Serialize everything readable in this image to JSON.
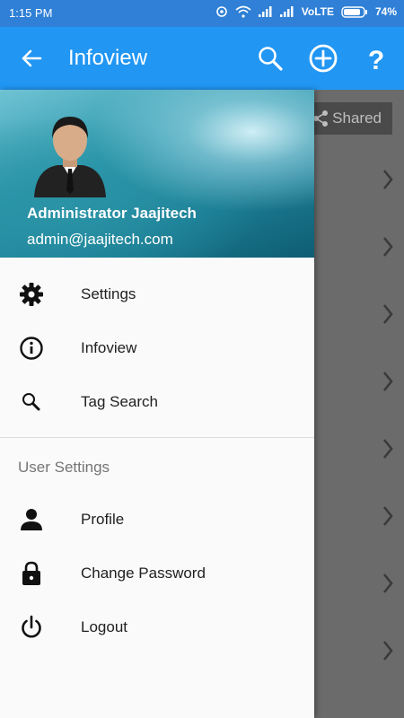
{
  "status_bar": {
    "time": "1:15 PM",
    "network": "VoLTE",
    "battery": "74%"
  },
  "app_bar": {
    "title": "Infoview",
    "icons": [
      "back-arrow-icon",
      "search-icon",
      "add-circle-icon",
      "help-icon"
    ]
  },
  "background": {
    "shared_label": "Shared"
  },
  "drawer": {
    "user": {
      "name": "Administrator Jaajitech",
      "email": "admin@jaajitech.com"
    },
    "menu": [
      {
        "label": "Settings",
        "icon": "gear-icon"
      },
      {
        "label": "Infoview",
        "icon": "info-icon"
      },
      {
        "label": "Tag Search",
        "icon": "search-icon"
      }
    ],
    "section_title": "User Settings",
    "user_menu": [
      {
        "label": "Profile",
        "icon": "person-icon"
      },
      {
        "label": "Change Password",
        "icon": "lock-icon"
      },
      {
        "label": "Logout",
        "icon": "power-icon"
      }
    ]
  },
  "colors": {
    "app_bar": "#2196f3",
    "status_bar": "#2f80d6",
    "drawer_bg": "#fafafa",
    "scrim": "#6b6b6b"
  }
}
